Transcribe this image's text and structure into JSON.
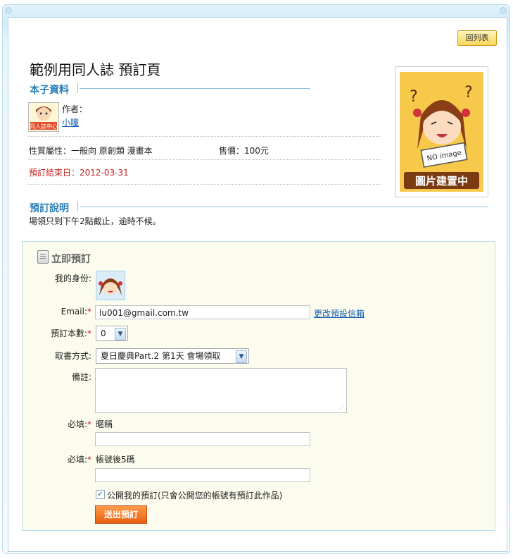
{
  "header": {
    "back_button_label": "回列表",
    "page_title": "範例用同人誌 預訂頁"
  },
  "book_info": {
    "section_title": "本子資料",
    "author_label": "作者：",
    "author_name": "小瞳",
    "thumb_text": "同人誌中心",
    "properties": "性質屬性：一般向 原創類 漫畫本",
    "price": "售價：100元",
    "deadline": "預訂結束日：2012-03-31",
    "cover_no_image": "NO image",
    "cover_caption": "圖片建置中"
  },
  "notes": {
    "section_title": "預訂說明",
    "text": "場領只到下午2點截止，逾時不候。"
  },
  "order_form": {
    "title": "立即預訂",
    "identity_label": "我的身份:",
    "email_label": "Email:",
    "email_value": "lu001@gmail.com.tw",
    "change_email_link": "更改預設信箱",
    "quantity_label": "預訂本數:",
    "quantity_value": "0",
    "pickup_label": "取書方式:",
    "pickup_value": "夏日慶典Part.2 第1天 會場領取",
    "remarks_label": "備註:",
    "required_label": "必填:",
    "nickname_label": "暱稱",
    "nickname_value": "",
    "account_label": "帳號後5碼",
    "account_value": "",
    "public_checkbox_label": "公開我的預訂(只會公開您的帳號有預訂此作品)",
    "public_checked": true,
    "submit_label": "送出預訂"
  },
  "colors": {
    "section_title": "#2a7fb8",
    "required_mark": "#cc2222",
    "link": "#1a5fb4",
    "submit_bg": "#e8600e",
    "form_bg": "#fcfcee"
  }
}
